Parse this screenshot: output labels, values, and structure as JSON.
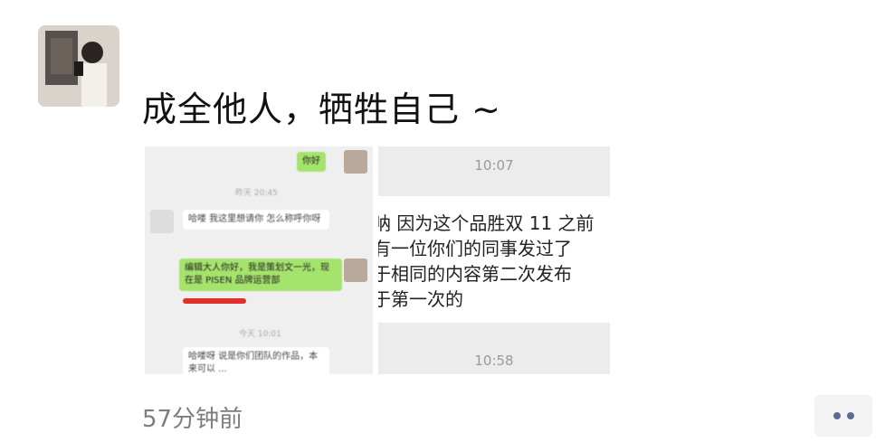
{
  "post": {
    "text": "成全他人，牺牲自己 ~",
    "time": "57分钟前"
  },
  "left_image": {
    "top_bubble": "你好",
    "sys_1": "昨天 20:45",
    "msg_1": "哈喽 我这里想请你 怎么称呼你呀",
    "msg_2": "编辑大人你好，我是策划文一光，现在是 PISEN 品牌运营部",
    "sys_2": "今天 10:01",
    "msg_3": "哈喽呀 说是你们团队的作品，本来可以 ..."
  },
  "right_image": {
    "time_top": "10:07",
    "lines": [
      "呐 因为这个品胜双 11 之前",
      "有一位你们的同事发过了",
      "于相同的内容第二次发布",
      "于第一次的"
    ],
    "time_bottom": "10:58"
  },
  "colors": {
    "chat_green": "#a5e46c",
    "link_blue": "#5b6d92"
  }
}
